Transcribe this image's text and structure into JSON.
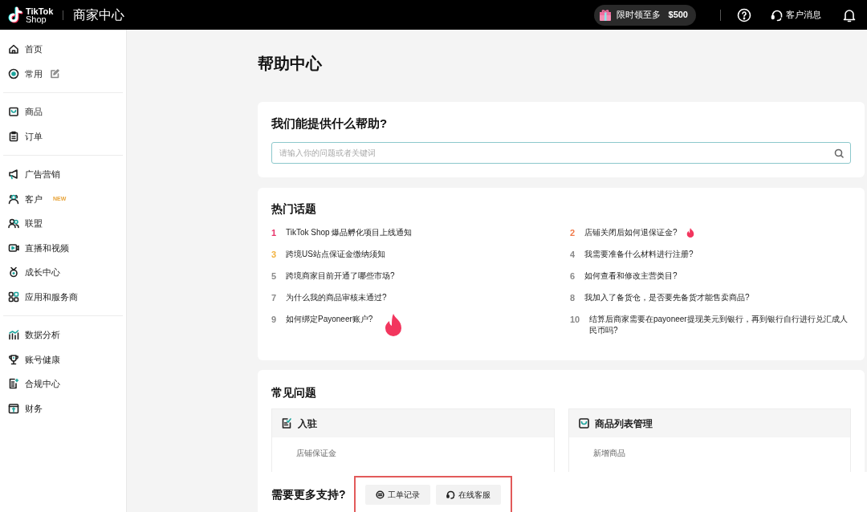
{
  "header": {
    "logo_top": "TikTok",
    "logo_bottom": "Shop",
    "title": "商家中心",
    "promo": {
      "label": "限时领至多",
      "amount": "$500"
    },
    "messages": "客户消息"
  },
  "sidebar": {
    "groups": [
      [
        {
          "label": "首页"
        },
        {
          "label": "常用",
          "editable": true
        }
      ],
      [
        {
          "label": "商品"
        },
        {
          "label": "订单"
        }
      ],
      [
        {
          "label": "广告营销"
        },
        {
          "label": "客户",
          "badge": "NEW"
        },
        {
          "label": "联盟"
        },
        {
          "label": "直播和视频"
        },
        {
          "label": "成长中心"
        },
        {
          "label": "应用和服务商"
        }
      ],
      [
        {
          "label": "数据分析"
        },
        {
          "label": "账号健康"
        },
        {
          "label": "合规中心"
        },
        {
          "label": "财务"
        }
      ]
    ]
  },
  "page_title": "帮助中心",
  "search": {
    "title": "我们能提供什么帮助?",
    "placeholder": "请输入你的问题或者关键词"
  },
  "hot_topics": {
    "title": "热门话题",
    "items": [
      {
        "rank": "1",
        "text": "TikTok Shop 爆品孵化项目上线通知",
        "color": "#e8356b",
        "kind": "plain"
      },
      {
        "rank": "2",
        "text": "店铺关闭后如何退保证金?",
        "color": "#f07a4a",
        "kind": "hot"
      },
      {
        "rank": "3",
        "text": "跨境US站点保证金缴纳须知",
        "color": "#f2b13c",
        "kind": "plain"
      },
      {
        "rank": "4",
        "text": "我需要准备什么材料进行注册?",
        "color": "#8a8a8a",
        "kind": "plain"
      },
      {
        "rank": "5",
        "text": "跨境商家目前开通了哪些市场?",
        "color": "#8a8a8a",
        "kind": "plain"
      },
      {
        "rank": "6",
        "text": "如何查看和修改主营类目?",
        "color": "#8a8a8a",
        "kind": "plain"
      },
      {
        "rank": "7",
        "text": "为什么我的商品审核未通过?",
        "color": "#8a8a8a",
        "kind": "plain"
      },
      {
        "rank": "8",
        "text": "我加入了备货仓，是否要先备货才能售卖商品?",
        "color": "#8a8a8a",
        "kind": "plain"
      },
      {
        "rank": "9",
        "text": "如何绑定Payoneer账户?",
        "color": "#8a8a8a",
        "kind": "featured"
      },
      {
        "rank": "10",
        "text": "结算后商家需要在payoneer提现美元到银行，再到银行自行进行兑汇成人民币吗?",
        "color": "#8a8a8a",
        "kind": "plain"
      }
    ]
  },
  "faq": {
    "title": "常见问题",
    "categories": [
      {
        "title": "入驻",
        "links": [
          "店铺保证金"
        ]
      },
      {
        "title": "商品列表管理",
        "links": [
          "新增商品"
        ]
      }
    ]
  },
  "support": {
    "title": "需要更多支持?",
    "highlighted": true,
    "buttons": [
      "工单记录",
      "在线客服"
    ]
  }
}
